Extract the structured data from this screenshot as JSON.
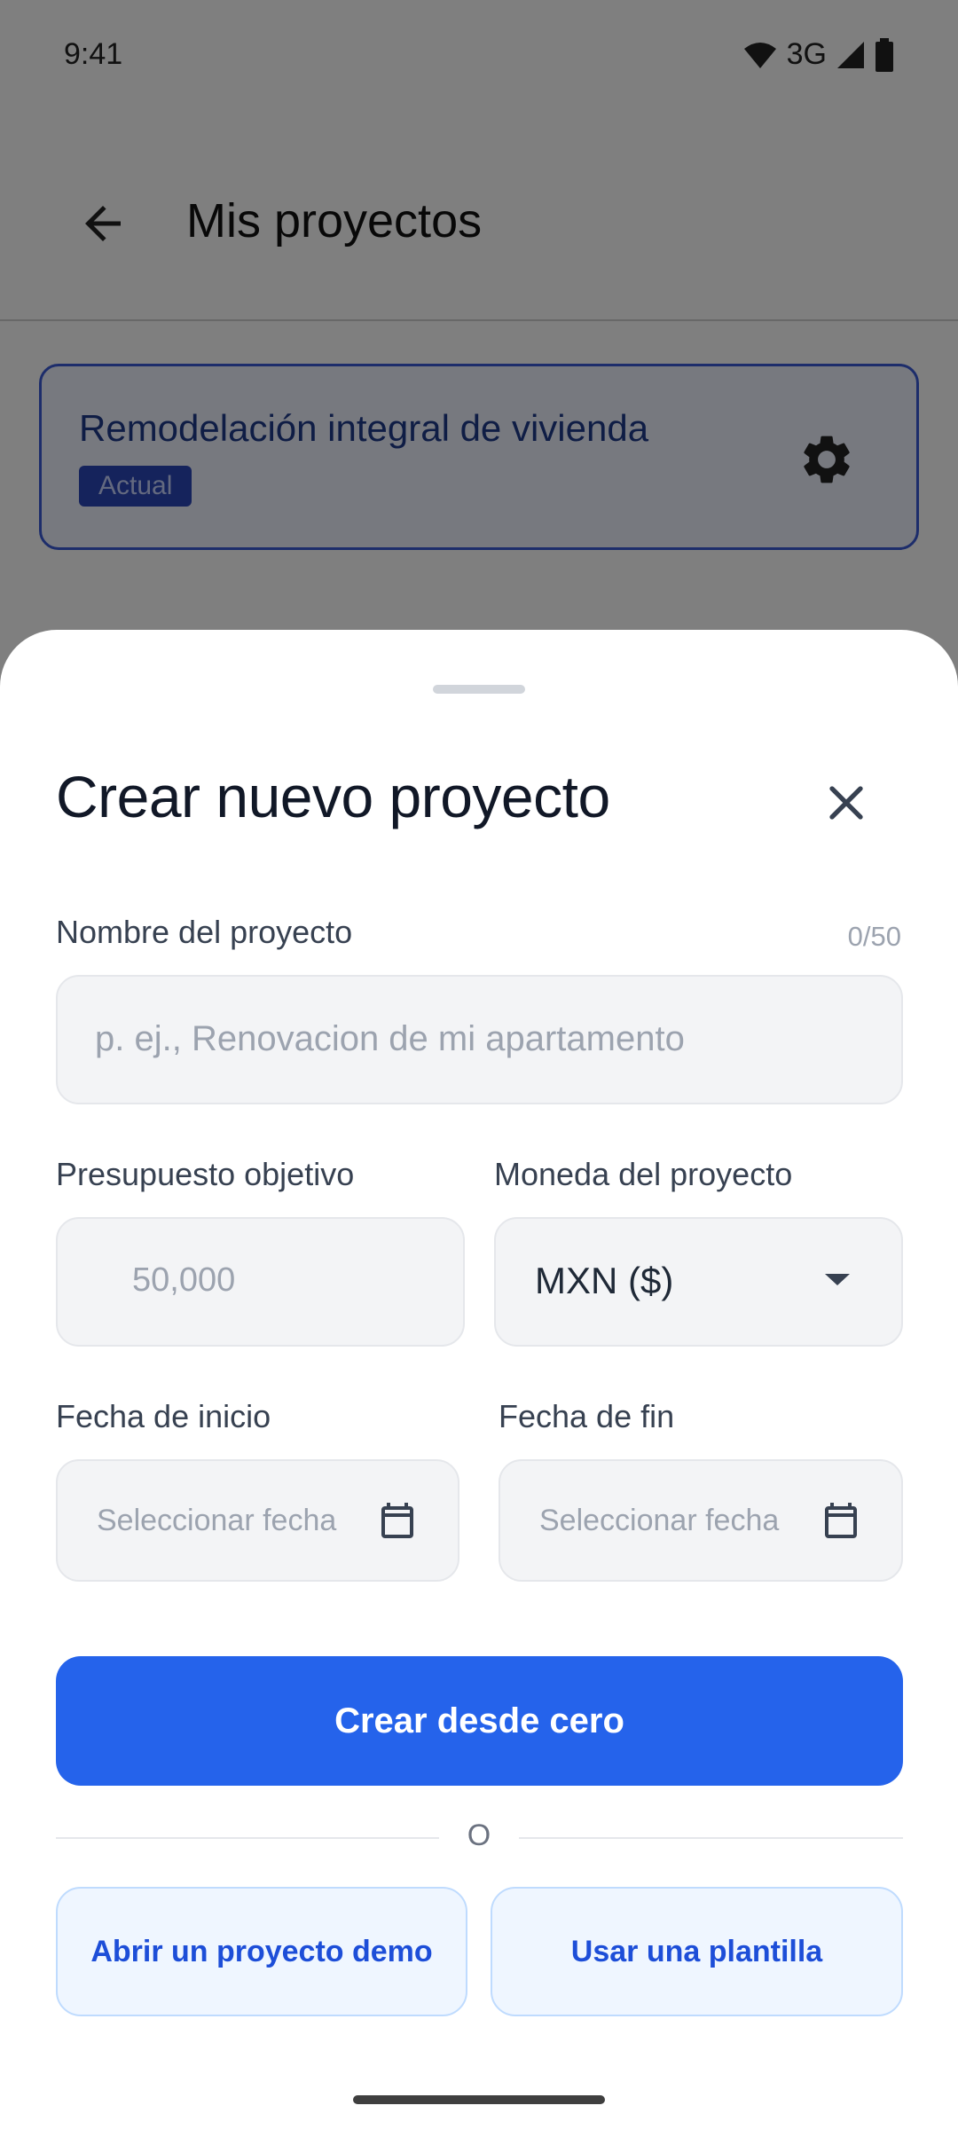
{
  "status_bar": {
    "time": "9:41",
    "network": "3G",
    "icons": [
      "wifi-icon",
      "signal-icon",
      "battery-icon"
    ]
  },
  "app_bar": {
    "title": "Mis proyectos",
    "back_icon": "arrow-left-icon"
  },
  "current_project": {
    "name": "Remodelación integral de vivienda",
    "badge": "Actual",
    "settings_icon": "gear-icon"
  },
  "sheet": {
    "title": "Crear nuevo proyecto",
    "close_icon": "close-icon",
    "name_field": {
      "label": "Nombre del proyecto",
      "counter": "0/50",
      "value": "",
      "placeholder": "p. ej., Renovacion de mi apartamento"
    },
    "budget_field": {
      "label": "Presupuesto objetivo",
      "value": "",
      "placeholder": "50,000"
    },
    "currency_field": {
      "label": "Moneda del proyecto",
      "selected": "MXN ($)"
    },
    "start_date": {
      "label": "Fecha de inicio",
      "placeholder": "Seleccionar fecha",
      "icon": "calendar-icon"
    },
    "end_date": {
      "label": "Fecha de fin",
      "placeholder": "Seleccionar fecha",
      "icon": "calendar-icon"
    },
    "create_button": "Crear desde cero",
    "divider_text": "O",
    "demo_button": "Abrir un proyecto demo",
    "template_button": "Usar una plantilla"
  },
  "colors": {
    "primary": "#2563eb",
    "secondary_bg": "#eff6ff",
    "secondary_text": "#1d4ed8",
    "scrim": "#00000080"
  }
}
